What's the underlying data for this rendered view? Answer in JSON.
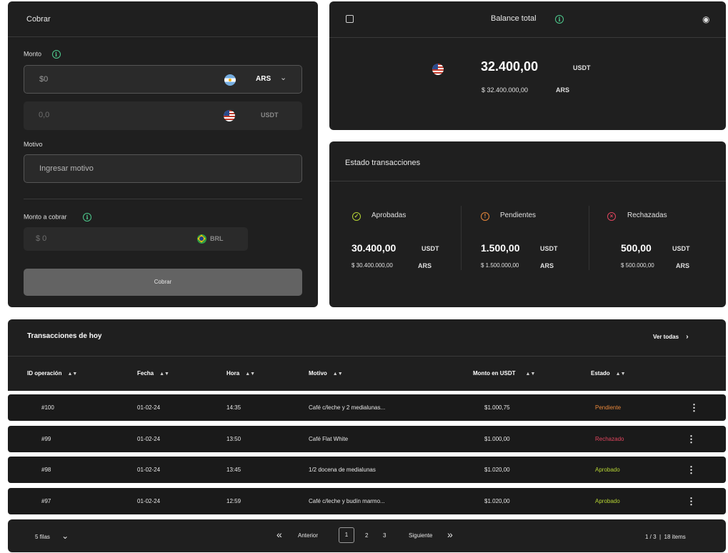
{
  "cobrar": {
    "title": "Cobrar",
    "monto_label": "Monto",
    "monto_value": "$0",
    "monto_currency": "ARS",
    "converted_value": "0,0",
    "converted_currency": "USDT",
    "motivo_label": "Motivo",
    "motivo_placeholder": "Ingresar motivo",
    "monto_cobrar_label": "Monto a cobrar",
    "monto_cobrar_value": "$ 0",
    "monto_cobrar_currency": "BRL",
    "button_label": "Cobrar"
  },
  "balance": {
    "title": "Balance total",
    "amount": "32.400,00",
    "amount_unit": "USDT",
    "secondary": "$ 32.400.000,00",
    "secondary_unit": "ARS"
  },
  "estado": {
    "title": "Estado transacciones",
    "groups": [
      {
        "label": "Aprobadas",
        "amount": "30.400,00",
        "unit": "USDT",
        "secondary": "$ 30.400.000,00",
        "secondary_unit": "ARS",
        "color": "#b5d334",
        "icon": "check-circle-icon"
      },
      {
        "label": "Pendientes",
        "amount": "1.500,00",
        "unit": "USDT",
        "secondary": "$ 1.500.000,00",
        "secondary_unit": "ARS",
        "color": "#e8873a",
        "icon": "alert-circle-icon"
      },
      {
        "label": "Rechazadas",
        "amount": "500,00",
        "unit": "USDT",
        "secondary": "$ 500.000,00",
        "secondary_unit": "ARS",
        "color": "#e0455e",
        "icon": "x-circle-icon"
      }
    ]
  },
  "transacciones": {
    "title": "Transacciones de hoy",
    "ver_todas": "Ver todas",
    "columns": [
      "ID operación",
      "Fecha",
      "Hora",
      "Motivo",
      "Monto en USDT",
      "Estado"
    ],
    "rows": [
      {
        "id": "#100",
        "fecha": "01-02-24",
        "hora": "14:35",
        "motivo": "Café c/leche y 2 medialunas...",
        "monto": "$1.000,75",
        "estado": "Pendiente",
        "estado_color": "#e8873a"
      },
      {
        "id": "#99",
        "fecha": "01-02-24",
        "hora": "13:50",
        "motivo": "Café Flat White",
        "monto": "$1.000,00",
        "estado": "Rechazado",
        "estado_color": "#e0455e"
      },
      {
        "id": "#98",
        "fecha": "01-02-24",
        "hora": "13:45",
        "motivo": "1/2 docena de medialunas",
        "monto": "$1.020,00",
        "estado": "Aprobado",
        "estado_color": "#b5d334"
      },
      {
        "id": "#97",
        "fecha": "01-02-24",
        "hora": "12:59",
        "motivo": "Café c/leche y budín marmo...",
        "monto": "$1.020,00",
        "estado": "Aprobado",
        "estado_color": "#b5d334"
      }
    ]
  },
  "pagination": {
    "rows_per_page": "5 filas",
    "prev": "Anterior",
    "next": "Siguiente",
    "pages": [
      "1",
      "2",
      "3"
    ],
    "summary": "1 / 3  |  18 items"
  }
}
